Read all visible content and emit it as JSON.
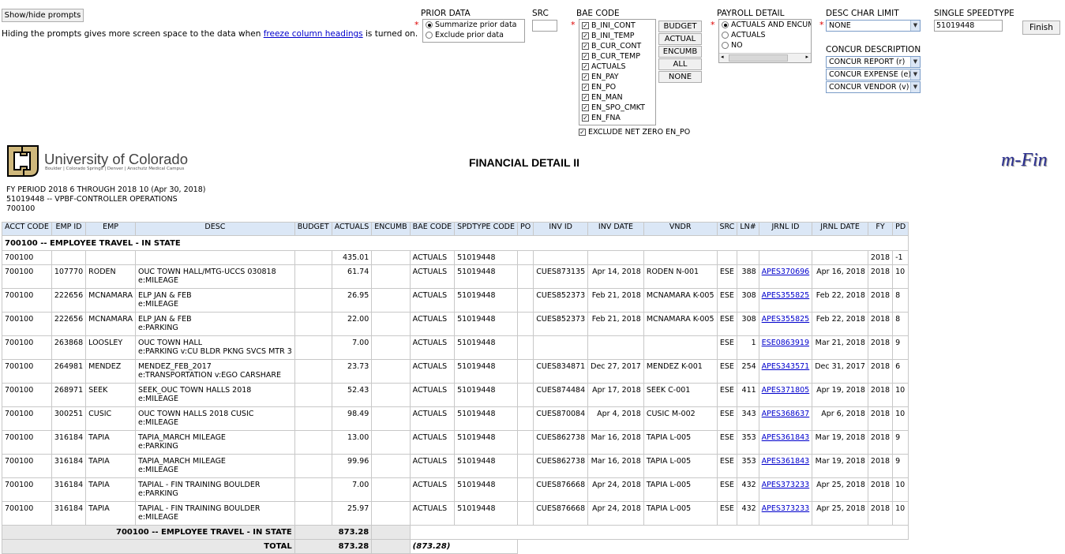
{
  "prompts": {
    "show_hide_label": "Show/hide prompts",
    "hint_prefix": "Hiding the prompts gives more screen space to the data when ",
    "hint_link": "freeze column headings",
    "hint_suffix": " is turned on.",
    "prior_data": {
      "label": "PRIOR DATA",
      "options": [
        "Summarize prior data",
        "Exclude prior data"
      ],
      "selected": 0
    },
    "src": {
      "label": "SRC",
      "value": ""
    },
    "bae_code": {
      "label": "BAE CODE",
      "items": [
        "B_INI_CONT",
        "B_INI_TEMP",
        "B_CUR_CONT",
        "B_CUR_TEMP",
        "ACTUALS",
        "EN_PAY",
        "EN_PO",
        "EN_MAN",
        "EN_SPO_CMKT",
        "EN_FNA"
      ],
      "buttons": [
        "BUDGET",
        "ACTUAL",
        "ENCUMB",
        "ALL",
        "NONE"
      ],
      "exclude_label": "EXCLUDE NET ZERO EN_PO"
    },
    "payroll_detail": {
      "label": "PAYROLL DETAIL",
      "options": [
        "ACTUALS AND ENCUMB",
        "ACTUALS",
        "NO"
      ],
      "selected": 0
    },
    "desc_char_limit": {
      "label": "DESC CHAR LIMIT",
      "value": "NONE"
    },
    "single_speedtype": {
      "label": "SINGLE SPEEDTYPE",
      "value": "51019448"
    },
    "finish_label": "Finish",
    "concur": {
      "label": "CONCUR DESCRIPTION",
      "selects": [
        "CONCUR REPORT (r)",
        "CONCUR EXPENSE (e)",
        "CONCUR VENDOR (v)"
      ]
    }
  },
  "report": {
    "university": "University of Colorado",
    "campuses": "Boulder | Colorado Springs | Denver | Anschutz Medical Campus",
    "title": "FINANCIAL DETAIL II",
    "brand": "m-Fin",
    "period": "FY PERIOD 2018 6 THROUGH 2018 10 (Apr 30, 2018)",
    "speedtype_line": "51019448 -- VPBF-CONTROLLER OPERATIONS",
    "account_line": "700100"
  },
  "table": {
    "columns": [
      "ACCT CODE",
      "EMP ID",
      "EMP",
      "DESC",
      "BUDGET",
      "ACTUALS",
      "ENCUMB",
      "BAE CODE",
      "SPDTYPE CODE",
      "PO",
      "INV ID",
      "INV DATE",
      "VNDR",
      "SRC",
      "LN#",
      "JRNL ID",
      "JRNL DATE",
      "FY",
      "PD"
    ],
    "group_header": "700100 -- EMPLOYEE TRAVEL - IN STATE",
    "rows": [
      {
        "acct": "700100",
        "empid": "",
        "emp": "",
        "desc1": "",
        "desc2": "",
        "budget": "",
        "actuals": "435.01",
        "encumb": "",
        "bae": "ACTUALS",
        "spd": "51019448",
        "po": "",
        "inv": "",
        "invdate": "",
        "vndr": "",
        "src": "",
        "ln": "",
        "jrnl": "",
        "jrnldate": "",
        "fy": "2018",
        "pd": "-1"
      },
      {
        "acct": "700100",
        "empid": "107770",
        "emp": "RODEN",
        "desc1": "OUC TOWN HALL/MTG-UCCS 030818",
        "desc2": "e:MILEAGE",
        "budget": "",
        "actuals": "61.74",
        "encumb": "",
        "bae": "ACTUALS",
        "spd": "51019448",
        "po": "",
        "inv": "CUES873135",
        "invdate": "Apr 14, 2018",
        "vndr": "RODEN N-001",
        "src": "ESE",
        "ln": "388",
        "jrnl": "APES370696",
        "jrnldate": "Apr 16, 2018",
        "fy": "2018",
        "pd": "10"
      },
      {
        "acct": "700100",
        "empid": "222656",
        "emp": "MCNAMARA",
        "desc1": "ELP JAN & FEB",
        "desc2": "e:MILEAGE",
        "budget": "",
        "actuals": "26.95",
        "encumb": "",
        "bae": "ACTUALS",
        "spd": "51019448",
        "po": "",
        "inv": "CUES852373",
        "invdate": "Feb 21, 2018",
        "vndr": "MCNAMARA K-005",
        "src": "ESE",
        "ln": "308",
        "jrnl": "APES355825",
        "jrnldate": "Feb 22, 2018",
        "fy": "2018",
        "pd": "8"
      },
      {
        "acct": "700100",
        "empid": "222656",
        "emp": "MCNAMARA",
        "desc1": "ELP JAN & FEB",
        "desc2": "e:PARKING",
        "budget": "",
        "actuals": "22.00",
        "encumb": "",
        "bae": "ACTUALS",
        "spd": "51019448",
        "po": "",
        "inv": "CUES852373",
        "invdate": "Feb 21, 2018",
        "vndr": "MCNAMARA K-005",
        "src": "ESE",
        "ln": "308",
        "jrnl": "APES355825",
        "jrnldate": "Feb 22, 2018",
        "fy": "2018",
        "pd": "8"
      },
      {
        "acct": "700100",
        "empid": "263868",
        "emp": "LOOSLEY",
        "desc1": "OUC TOWN HALL",
        "desc2": "e:PARKING v:CU BLDR PKNG SVCS MTR 3",
        "budget": "",
        "actuals": "7.00",
        "encumb": "",
        "bae": "ACTUALS",
        "spd": "51019448",
        "po": "",
        "inv": "",
        "invdate": "",
        "vndr": "",
        "src": "ESE",
        "ln": "1",
        "jrnl": "ESE0863919",
        "jrnldate": "Mar 21, 2018",
        "fy": "2018",
        "pd": "9"
      },
      {
        "acct": "700100",
        "empid": "264981",
        "emp": "MENDEZ",
        "desc1": "MENDEZ_FEB_2017",
        "desc2": "e:TRANSPORTATION v:EGO CARSHARE",
        "budget": "",
        "actuals": "23.73",
        "encumb": "",
        "bae": "ACTUALS",
        "spd": "51019448",
        "po": "",
        "inv": "CUES834871",
        "invdate": "Dec 27, 2017",
        "vndr": "MENDEZ K-001",
        "src": "ESE",
        "ln": "254",
        "jrnl": "APES343571",
        "jrnldate": "Dec 31, 2017",
        "fy": "2018",
        "pd": "6"
      },
      {
        "acct": "700100",
        "empid": "268971",
        "emp": "SEEK",
        "desc1": "SEEK_OUC TOWN HALLS 2018",
        "desc2": "e:MILEAGE",
        "budget": "",
        "actuals": "52.43",
        "encumb": "",
        "bae": "ACTUALS",
        "spd": "51019448",
        "po": "",
        "inv": "CUES874484",
        "invdate": "Apr 17, 2018",
        "vndr": "SEEK C-001",
        "src": "ESE",
        "ln": "411",
        "jrnl": "APES371805",
        "jrnldate": "Apr 19, 2018",
        "fy": "2018",
        "pd": "10"
      },
      {
        "acct": "700100",
        "empid": "300251",
        "emp": "CUSIC",
        "desc1": "OUC TOWN HALLS 2018 CUSIC",
        "desc2": "e:MILEAGE",
        "budget": "",
        "actuals": "98.49",
        "encumb": "",
        "bae": "ACTUALS",
        "spd": "51019448",
        "po": "",
        "inv": "CUES870084",
        "invdate": "Apr 4, 2018",
        "vndr": "CUSIC M-002",
        "src": "ESE",
        "ln": "343",
        "jrnl": "APES368637",
        "jrnldate": "Apr 6, 2018",
        "fy": "2018",
        "pd": "10"
      },
      {
        "acct": "700100",
        "empid": "316184",
        "emp": "TAPIA",
        "desc1": "TAPIA_MARCH MILEAGE",
        "desc2": "e:PARKING",
        "budget": "",
        "actuals": "13.00",
        "encumb": "",
        "bae": "ACTUALS",
        "spd": "51019448",
        "po": "",
        "inv": "CUES862738",
        "invdate": "Mar 16, 2018",
        "vndr": "TAPIA L-005",
        "src": "ESE",
        "ln": "353",
        "jrnl": "APES361843",
        "jrnldate": "Mar 19, 2018",
        "fy": "2018",
        "pd": "9"
      },
      {
        "acct": "700100",
        "empid": "316184",
        "emp": "TAPIA",
        "desc1": "TAPIA_MARCH MILEAGE",
        "desc2": "e:MILEAGE",
        "budget": "",
        "actuals": "99.96",
        "encumb": "",
        "bae": "ACTUALS",
        "spd": "51019448",
        "po": "",
        "inv": "CUES862738",
        "invdate": "Mar 16, 2018",
        "vndr": "TAPIA L-005",
        "src": "ESE",
        "ln": "353",
        "jrnl": "APES361843",
        "jrnldate": "Mar 19, 2018",
        "fy": "2018",
        "pd": "9"
      },
      {
        "acct": "700100",
        "empid": "316184",
        "emp": "TAPIA",
        "desc1": "TAPIAL - FIN TRAINING BOULDER",
        "desc2": "e:PARKING",
        "budget": "",
        "actuals": "7.00",
        "encumb": "",
        "bae": "ACTUALS",
        "spd": "51019448",
        "po": "",
        "inv": "CUES876668",
        "invdate": "Apr 24, 2018",
        "vndr": "TAPIA L-005",
        "src": "ESE",
        "ln": "432",
        "jrnl": "APES373233",
        "jrnldate": "Apr 25, 2018",
        "fy": "2018",
        "pd": "10"
      },
      {
        "acct": "700100",
        "empid": "316184",
        "emp": "TAPIA",
        "desc1": "TAPIAL - FIN TRAINING BOULDER",
        "desc2": "e:MILEAGE",
        "budget": "",
        "actuals": "25.97",
        "encumb": "",
        "bae": "ACTUALS",
        "spd": "51019448",
        "po": "",
        "inv": "CUES876668",
        "invdate": "Apr 24, 2018",
        "vndr": "TAPIA L-005",
        "src": "ESE",
        "ln": "432",
        "jrnl": "APES373233",
        "jrnldate": "Apr 25, 2018",
        "fy": "2018",
        "pd": "10"
      }
    ],
    "subtotal_label": "700100 -- EMPLOYEE TRAVEL - IN STATE",
    "subtotal_actuals": "873.28",
    "total_label": "TOTAL",
    "total_actuals": "873.28",
    "total_variance": "(873.28)"
  }
}
